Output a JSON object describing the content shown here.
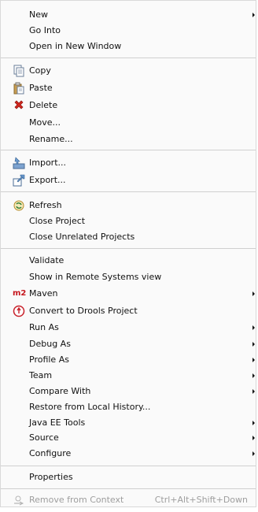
{
  "menu": {
    "items": {
      "new": {
        "label": "New"
      },
      "go_into": {
        "label": "Go Into"
      },
      "open_new_window": {
        "label": "Open in New Window"
      },
      "copy": {
        "label": "Copy"
      },
      "paste": {
        "label": "Paste"
      },
      "delete": {
        "label": "Delete"
      },
      "move": {
        "label": "Move..."
      },
      "rename": {
        "label": "Rename..."
      },
      "import": {
        "label": "Import..."
      },
      "export": {
        "label": "Export..."
      },
      "refresh": {
        "label": "Refresh"
      },
      "close_project": {
        "label": "Close Project"
      },
      "close_unrelated": {
        "label": "Close Unrelated Projects"
      },
      "validate": {
        "label": "Validate"
      },
      "show_remote": {
        "label": "Show in Remote Systems view"
      },
      "maven": {
        "label": "Maven",
        "badge": "m2"
      },
      "convert_drools": {
        "label": "Convert to Drools Project"
      },
      "run_as": {
        "label": "Run As"
      },
      "debug_as": {
        "label": "Debug As"
      },
      "profile_as": {
        "label": "Profile As"
      },
      "team": {
        "label": "Team"
      },
      "compare_with": {
        "label": "Compare With"
      },
      "restore_local": {
        "label": "Restore from Local History..."
      },
      "java_ee_tools": {
        "label": "Java EE Tools"
      },
      "source": {
        "label": "Source"
      },
      "configure": {
        "label": "Configure"
      },
      "properties": {
        "label": "Properties"
      },
      "remove_context": {
        "label": "Remove from Context",
        "shortcut": "Ctrl+Alt+Shift+Down"
      }
    }
  },
  "icons": {
    "copy": "copy-icon",
    "paste": "paste-icon",
    "delete": "delete-icon",
    "import": "import-icon",
    "export": "export-icon",
    "refresh": "refresh-icon",
    "drools": "drools-icon",
    "remove_context": "remove-context-icon"
  },
  "colors": {
    "maven_badge": "#c5161d",
    "delete_icon": "#d0271f"
  }
}
